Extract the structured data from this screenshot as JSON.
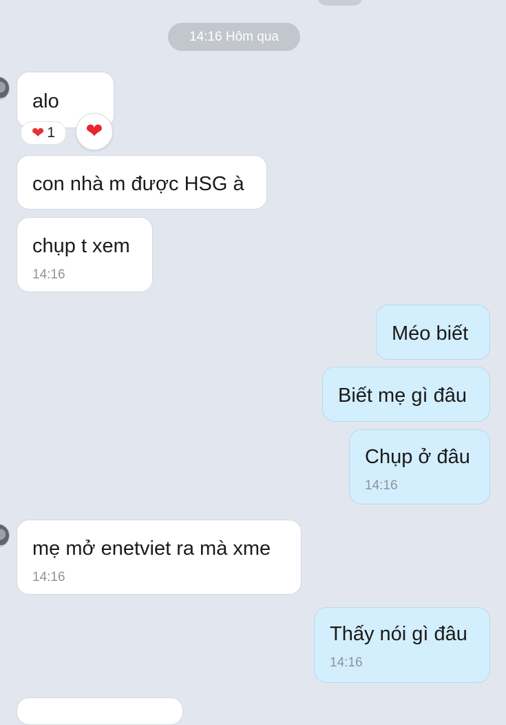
{
  "date_separator": "14:16 Hôm qua",
  "messages": [
    {
      "text": "alo"
    },
    {
      "text": "con nhà m được HSG à"
    },
    {
      "text": "chụp t xem",
      "time": "14:16"
    },
    {
      "text": "Méo biết"
    },
    {
      "text": "Biết mẹ gì đâu"
    },
    {
      "text": "Chụp ở đâu",
      "time": "14:16"
    },
    {
      "text": "mẹ mở enetviet ra mà xme",
      "time": "14:16"
    },
    {
      "text": "Thấy nói gì đâu",
      "time": "14:16"
    }
  ],
  "reaction": {
    "emoji": "❤",
    "count": "1",
    "quick_emoji": "❤"
  },
  "colors": {
    "background": "#e2e7ef",
    "incoming": "#ffffff",
    "outgoing": "#d3eefc",
    "heart": "#e8262f"
  }
}
